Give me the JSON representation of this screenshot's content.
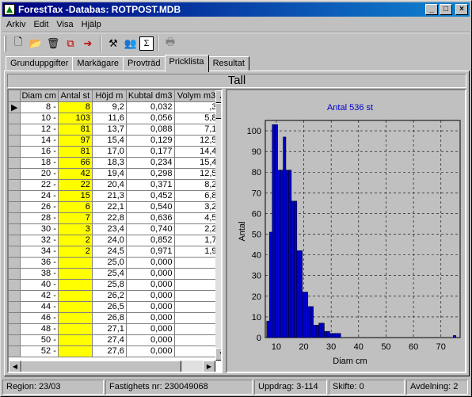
{
  "window": {
    "title": "ForestTax -Databas: ROTPOST.MDB"
  },
  "menu": [
    "Arkiv",
    "Edit",
    "Visa",
    "Hjälp"
  ],
  "toolbar": [
    {
      "name": "new-icon",
      "glyph": "🗋"
    },
    {
      "name": "open-icon",
      "glyph": "📂"
    },
    {
      "name": "delete-icon",
      "glyph": "🗑"
    },
    {
      "name": "copy-icon",
      "glyph": "⧉"
    },
    {
      "name": "export-icon",
      "glyph": "➔"
    },
    {
      "name": "tools-icon",
      "glyph": "⚒"
    },
    {
      "name": "users-icon",
      "glyph": "👥"
    },
    {
      "name": "sum-icon",
      "glyph": "Σ"
    },
    {
      "name": "print-icon",
      "glyph": "🖶"
    }
  ],
  "tabs": [
    "Grunduppgifter",
    "Markägare",
    "Provträd",
    "Pricklista",
    "Resultat"
  ],
  "active_tab": 3,
  "section_title": "Tall",
  "table": {
    "columns": [
      "Diam cm",
      "Antal st",
      "Höjd m",
      "Kubtal dm3",
      "Volym m3"
    ],
    "rows": [
      [
        "8 -",
        "8",
        "9,2",
        "0,032",
        ",3"
      ],
      [
        "10 -",
        "103",
        "11,6",
        "0,056",
        "5,8"
      ],
      [
        "12 -",
        "81",
        "13,7",
        "0,088",
        "7,1"
      ],
      [
        "14 -",
        "97",
        "15,4",
        "0,129",
        "12,5"
      ],
      [
        "16 -",
        "81",
        "17,0",
        "0,177",
        "14,4"
      ],
      [
        "18 -",
        "66",
        "18,3",
        "0,234",
        "15,4"
      ],
      [
        "20 -",
        "42",
        "19,4",
        "0,298",
        "12,5"
      ],
      [
        "22 -",
        "22",
        "20,4",
        "0,371",
        "8,2"
      ],
      [
        "24 -",
        "15",
        "21,3",
        "0,452",
        "6,8"
      ],
      [
        "26 -",
        "6",
        "22,1",
        "0,540",
        "3,2"
      ],
      [
        "28 -",
        "7",
        "22,8",
        "0,636",
        "4,5"
      ],
      [
        "30 -",
        "3",
        "23,4",
        "0,740",
        "2,2"
      ],
      [
        "32 -",
        "2",
        "24,0",
        "0,852",
        "1,7"
      ],
      [
        "34 -",
        "2",
        "24,5",
        "0,971",
        "1,9"
      ],
      [
        "36 -",
        "",
        "25,0",
        "0,000",
        ""
      ],
      [
        "38 -",
        "",
        "25,4",
        "0,000",
        ""
      ],
      [
        "40 -",
        "",
        "25,8",
        "0,000",
        ""
      ],
      [
        "42 -",
        "",
        "26,2",
        "0,000",
        ""
      ],
      [
        "44 -",
        "",
        "26,5",
        "0,000",
        ""
      ],
      [
        "46 -",
        "",
        "26,8",
        "0,000",
        ""
      ],
      [
        "48 -",
        "",
        "27,1",
        "0,000",
        ""
      ],
      [
        "50 -",
        "",
        "27,4",
        "0,000",
        ""
      ],
      [
        "52 -",
        "",
        "27,6",
        "0,000",
        ""
      ]
    ]
  },
  "chart_data": {
    "type": "bar",
    "title": "Antal 536 st",
    "xlabel": "Diam cm",
    "ylabel": "Antal",
    "xlim": [
      6,
      77
    ],
    "ylim": [
      0,
      105
    ],
    "xticks": [
      10,
      20,
      30,
      40,
      50,
      60,
      70
    ],
    "yticks": [
      0,
      10,
      20,
      30,
      40,
      50,
      60,
      70,
      80,
      90,
      100
    ],
    "grid": true,
    "bar_color": "#0000cc",
    "bars": [
      {
        "x": 7,
        "value": 8
      },
      {
        "x": 8,
        "value": 51
      },
      {
        "x": 9,
        "value": 103
      },
      {
        "x": 10,
        "value": 103
      },
      {
        "x": 11,
        "value": 81
      },
      {
        "x": 12,
        "value": 81
      },
      {
        "x": 13,
        "value": 97
      },
      {
        "x": 14,
        "value": 81
      },
      {
        "x": 15,
        "value": 81
      },
      {
        "x": 16,
        "value": 66
      },
      {
        "x": 17,
        "value": 66
      },
      {
        "x": 18,
        "value": 42
      },
      {
        "x": 19,
        "value": 42
      },
      {
        "x": 20,
        "value": 22
      },
      {
        "x": 21,
        "value": 22
      },
      {
        "x": 22,
        "value": 15
      },
      {
        "x": 23,
        "value": 15
      },
      {
        "x": 24,
        "value": 6
      },
      {
        "x": 25,
        "value": 6
      },
      {
        "x": 26,
        "value": 7
      },
      {
        "x": 27,
        "value": 7
      },
      {
        "x": 28,
        "value": 3
      },
      {
        "x": 29,
        "value": 3
      },
      {
        "x": 30,
        "value": 2
      },
      {
        "x": 31,
        "value": 2
      },
      {
        "x": 32,
        "value": 2
      },
      {
        "x": 33,
        "value": 2
      },
      {
        "x": 75,
        "value": 1
      }
    ]
  },
  "status": {
    "region": "Region: 23/03",
    "fastighet": "Fastighets nr: 230049068",
    "uppdrag": "Uppdrag: 3-114",
    "skifte": "Skifte: 0",
    "avdelning": "Avdelning: 2"
  }
}
